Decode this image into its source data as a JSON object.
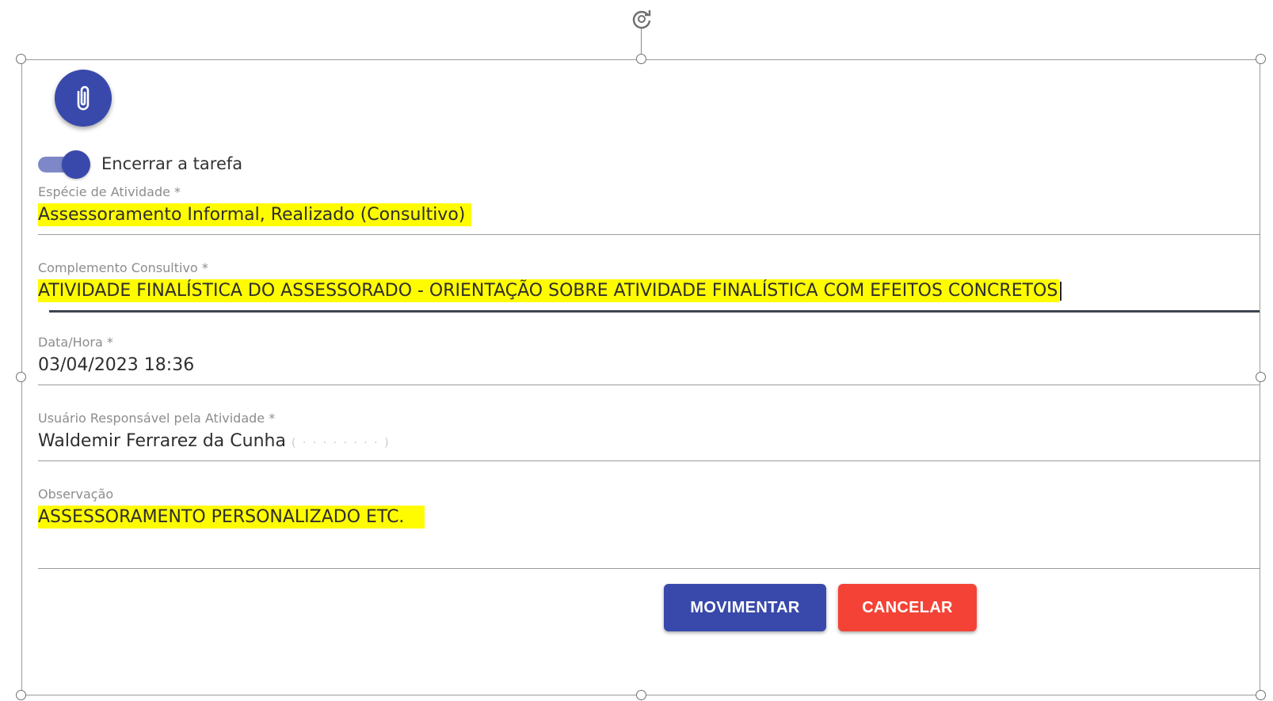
{
  "actions": {
    "attach_icon": "paperclip-icon",
    "rotate_icon": "rotate-icon"
  },
  "toggle": {
    "label": "Encerrar a tarefa",
    "checked": true
  },
  "fields": {
    "especie": {
      "label": "Espécie de Atividade *",
      "value": "Assessoramento Informal, Realizado (Consultivo)"
    },
    "complemento": {
      "label": "Complemento Consultivo",
      "required_mark": "*",
      "value": "ATIVIDADE FINALÍSTICA DO ASSESSORADO - ORIENTAÇÃO SOBRE ATIVIDADE FINALÍSTICA COM EFEITOS CONCRETOS"
    },
    "data_hora": {
      "label": "Data/Hora *",
      "value": "03/04/2023 18:36"
    },
    "usuario": {
      "label": "Usuário Responsável pela Atividade *",
      "value": "Waldemir Ferrarez da Cunha"
    },
    "observacao": {
      "label": "Observação",
      "value": "ASSESSORAMENTO PERSONALIZADO ETC."
    }
  },
  "buttons": {
    "movimentar": "MOVIMENTAR",
    "cancelar": "CANCELAR"
  },
  "colors": {
    "primary": "#3949ab",
    "danger": "#f44336",
    "highlight": "#fffc00"
  }
}
